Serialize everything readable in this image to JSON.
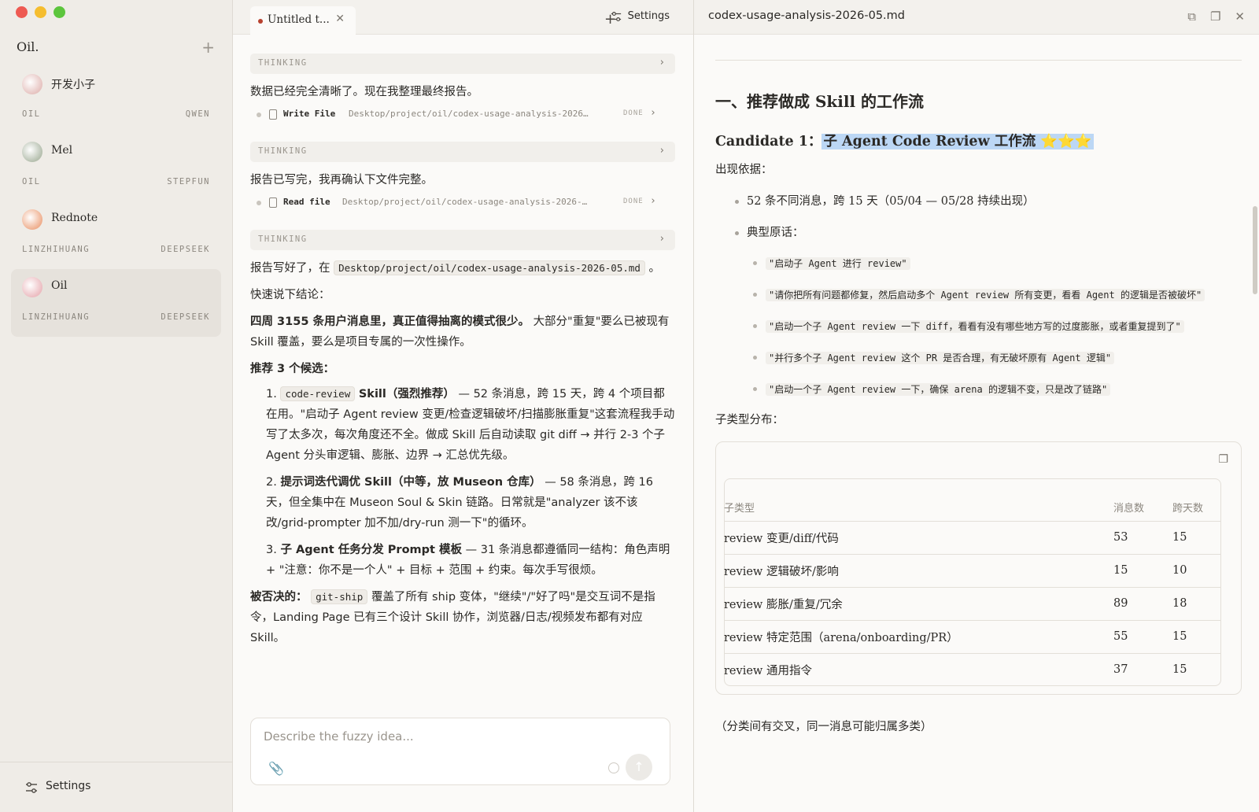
{
  "sidebar": {
    "brand": "Oil.",
    "sessions": [
      {
        "name": "开发小子",
        "tag_left": "OIL",
        "tag_right": "QWEN",
        "avatar_color": "#e6c3c0"
      },
      {
        "name": "Mel",
        "tag_left": "OIL",
        "tag_right": "STEPFUN",
        "avatar_color": "#b5bfae"
      },
      {
        "name": "Rednote",
        "tag_left": "LINZHIHUANG",
        "tag_right": "DEEPSEEK",
        "avatar_color": "#efae8d"
      },
      {
        "name": "Oil",
        "tag_left": "LINZHIHUANG",
        "tag_right": "DEEPSEEK",
        "avatar_color": "#ecbcc1"
      }
    ],
    "settings_label": "Settings"
  },
  "chat": {
    "tab_title": "Untitled t...",
    "settings_label": "Settings",
    "thinking_label": "THINKING",
    "msg1": "数据已经完全清晰了。现在我整理最终报告。",
    "tool1": {
      "name": "Write File",
      "path": "Desktop/project/oil/codex-usage-analysis-2026…",
      "status": "DONE"
    },
    "msg2": "报告已写完，我再确认下文件完整。",
    "tool2": {
      "name": "Read file",
      "path": "Desktop/project/oil/codex-usage-analysis-2026-…",
      "status": "DONE"
    },
    "msg3_prefix": "报告写好了，在",
    "msg3_code": "Desktop/project/oil/codex-usage-analysis-2026-05.md",
    "msg3_suffix": "。",
    "quick": "快速说下结论：",
    "summary_bold": "四周 3155 条用户消息里，真正值得抽离的模式很少。",
    "summary_rest": "大部分\"重复\"要么已被现有 Skill 覆盖，要么是项目专属的一次性操作。",
    "rec_title": "推荐 3 个候选：",
    "item1_num": "1.",
    "item1_code": "code-review",
    "item1_bold": "Skill（强烈推荐）",
    "item1_rest": "— 52 条消息，跨 15 天，跨 4 个项目都在用。\"启动子 Agent review 变更/检查逻辑破坏/扫描膨胀重复\"这套流程我手动写了太多次，每次角度还不全。做成 Skill 后自动读取 git diff → 并行 2-3 个子 Agent 分头审逻辑、膨胀、边界 → 汇总优先级。",
    "item2_num": "2.",
    "item2_bold": "提示词迭代调优 Skill（中等，放 Museon 仓库）",
    "item2_rest": "— 58 条消息，跨 16 天，但全集中在 Museon Soul & Skin 链路。日常就是\"analyzer 该不该改/grid-prompter 加不加/dry-run 测一下\"的循环。",
    "item3_num": "3.",
    "item3_bold": "子 Agent 任务分发 Prompt 模板",
    "item3_rest": "— 31 条消息都遵循同一结构：角色声明 + \"注意：你不是一个人\" + 目标 + 范围 + 约束。每次手写很烦。",
    "rejected_bold": "被否决的：",
    "rejected_code": "git-ship",
    "rejected_rest": "覆盖了所有 ship 变体，\"继续\"/\"好了吗\"是交互词不是指令，Landing Page 已有三个设计 Skill 协作，浏览器/日志/视频发布都有对应 Skill。",
    "composer_placeholder": "Describe the fuzzy idea..."
  },
  "doc": {
    "filename": "codex-usage-analysis-2026-05.md",
    "h2": "一、推荐做成 Skill 的工作流",
    "h3_prefix": "Candidate 1：",
    "h3_highlight": "子 Agent Code Review 工作流 ⭐⭐⭐",
    "evidence_label": "出现依据：",
    "bullet1": "52 条不同消息，跨 15 天（05/04 — 05/28 持续出现）",
    "bullet2": "典型原话：",
    "quotes": [
      "\"启动子 Agent 进行 review\"",
      "\"请你把所有问题都修复，然后启动多个 Agent review 所有变更，看看 Agent 的逻辑是否被破坏\"",
      "\"启动一个子 Agent review 一下 diff，看看有没有哪些地方写的过度膨胀，或者重复提到了\"",
      "\"并行多个子 Agent review 这个 PR 是否合理，有无破坏原有 Agent 逻辑\"",
      "\"启动一个子 Agent review 一下，确保 arena 的逻辑不变，只是改了链路\""
    ],
    "dist_label": "子类型分布：",
    "table": {
      "headers": [
        "子类型",
        "消息数",
        "跨天数"
      ],
      "rows": [
        [
          "review 变更/diff/代码",
          "53",
          "15"
        ],
        [
          "review 逻辑破坏/影响",
          "15",
          "10"
        ],
        [
          "review 膨胀/重复/冗余",
          "89",
          "18"
        ],
        [
          "review 特定范围（arena/onboarding/PR）",
          "55",
          "15"
        ],
        [
          "review 通用指令",
          "37",
          "15"
        ]
      ]
    },
    "footnote": "（分类间有交叉，同一消息可能归属多类）"
  }
}
